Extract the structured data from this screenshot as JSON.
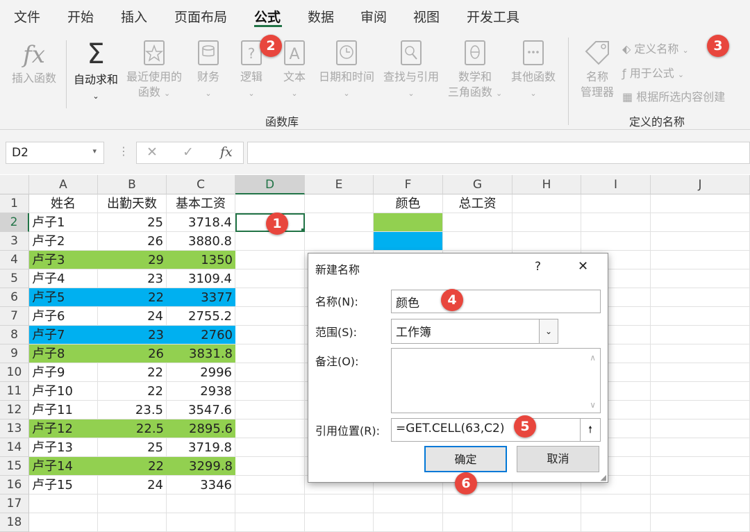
{
  "ribbon_tabs": [
    "文件",
    "开始",
    "插入",
    "页面布局",
    "公式",
    "数据",
    "审阅",
    "视图",
    "开发工具"
  ],
  "active_tab": "公式",
  "ribbon": {
    "insert_function": "插入函数",
    "autosum": "自动求和",
    "recent_line1": "最近使用的",
    "recent_line2": "函数",
    "financial": "财务",
    "logical": "逻辑",
    "text": "文本",
    "datetime": "日期和时间",
    "lookup": "查找与引用",
    "math_line1": "数学和",
    "math_line2": "三角函数",
    "other": "其他函数",
    "library_label": "函数库",
    "name_mgr_line1": "名称",
    "name_mgr_line2": "管理器",
    "define_name": "定义名称",
    "use_in_formula": "用于公式",
    "create_from_selection": "根据所选内容创建",
    "defined_names_label": "定义的名称"
  },
  "formula_bar": {
    "name_box": "D2",
    "fx": "fx"
  },
  "columns": [
    "A",
    "B",
    "C",
    "D",
    "E",
    "F",
    "G",
    "H",
    "I",
    "J"
  ],
  "selected_column": "D",
  "selected_row": 2,
  "headers": {
    "a": "姓名",
    "b": "出勤天数",
    "c": "基本工资",
    "f": "颜色",
    "g": "总工资"
  },
  "rows": [
    {
      "name": "卢子1",
      "days": "25",
      "salary": "3718.4",
      "fill": ""
    },
    {
      "name": "卢子2",
      "days": "26",
      "salary": "3880.8",
      "fill": ""
    },
    {
      "name": "卢子3",
      "days": "29",
      "salary": "1350",
      "fill": "green"
    },
    {
      "name": "卢子4",
      "days": "23",
      "salary": "3109.4",
      "fill": ""
    },
    {
      "name": "卢子5",
      "days": "22",
      "salary": "3377",
      "fill": "blue"
    },
    {
      "name": "卢子6",
      "days": "24",
      "salary": "2755.2",
      "fill": ""
    },
    {
      "name": "卢子7",
      "days": "23",
      "salary": "2760",
      "fill": "blue"
    },
    {
      "name": "卢子8",
      "days": "26",
      "salary": "3831.8",
      "fill": "green"
    },
    {
      "name": "卢子9",
      "days": "22",
      "salary": "2996",
      "fill": ""
    },
    {
      "name": "卢子10",
      "days": "22",
      "salary": "2938",
      "fill": ""
    },
    {
      "name": "卢子11",
      "days": "23.5",
      "salary": "3547.6",
      "fill": ""
    },
    {
      "name": "卢子12",
      "days": "22.5",
      "salary": "2895.6",
      "fill": "green"
    },
    {
      "name": "卢子13",
      "days": "25",
      "salary": "3719.8",
      "fill": ""
    },
    {
      "name": "卢子14",
      "days": "22",
      "salary": "3299.8",
      "fill": "green"
    },
    {
      "name": "卢子15",
      "days": "24",
      "salary": "3346",
      "fill": ""
    }
  ],
  "colors": {
    "green": "#92d050",
    "blue": "#00b0f0",
    "accent": "#217346",
    "badge": "#e8463d"
  },
  "dialog": {
    "title": "新建名称",
    "help": "?",
    "close": "✕",
    "name_label": "名称(N):",
    "name_value": "颜色",
    "scope_label": "范围(S):",
    "scope_value": "工作簿",
    "comment_label": "备注(O):",
    "ref_label": "引用位置(R):",
    "ref_value": "=GET.CELL(63,C2)",
    "ok": "确定",
    "cancel": "取消"
  },
  "badges": [
    "1",
    "2",
    "3",
    "4",
    "5",
    "6"
  ]
}
